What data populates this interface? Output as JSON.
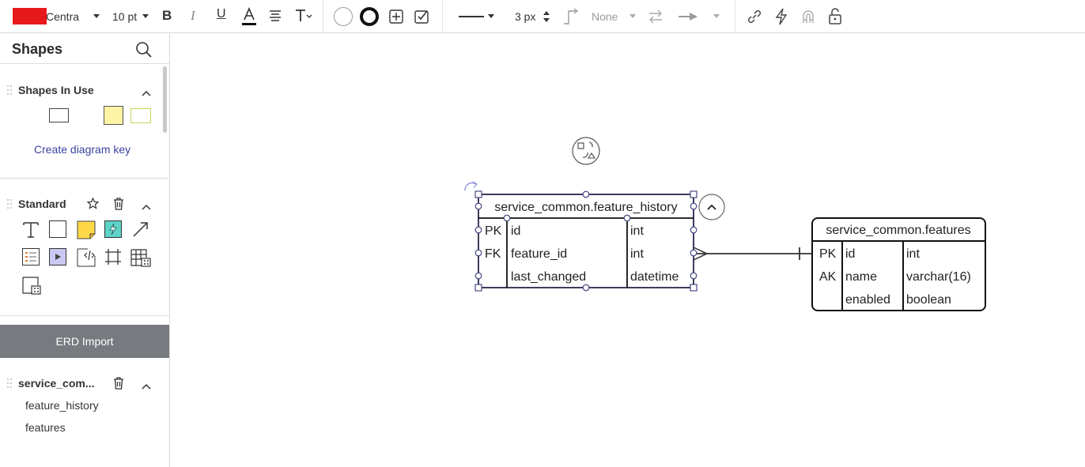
{
  "toolbar": {
    "font_name": "Centra",
    "font_size": "10 pt",
    "line_width": "3 px",
    "endpoint": "None",
    "colors": {
      "fill_swatch": "#e8191b",
      "text_underline": "#111111"
    }
  },
  "sidebar": {
    "title": "Shapes",
    "shapes_in_use": {
      "title": "Shapes In Use",
      "create_key": "Create diagram key",
      "swatches": [
        "#ffffff",
        "#fff3a6",
        "#ffffff"
      ]
    },
    "standard": {
      "title": "Standard"
    },
    "erd_import": "ERD Import",
    "library": {
      "title": "service_com...",
      "items": [
        "feature_history",
        "features"
      ]
    }
  },
  "diagram": {
    "table1": {
      "title": "service_common.feature_history",
      "rows": [
        {
          "key": "PK",
          "name": "id",
          "type": "int"
        },
        {
          "key": "FK",
          "name": "feature_id",
          "type": "int"
        },
        {
          "key": "",
          "name": "last_changed",
          "type": "datetime"
        }
      ]
    },
    "table2": {
      "title": "service_common.features",
      "rows": [
        {
          "key": "PK",
          "name": "id",
          "type": "int"
        },
        {
          "key": "AK",
          "name": "name",
          "type": "varchar(16)"
        },
        {
          "key": "",
          "name": "enabled",
          "type": "boolean"
        }
      ]
    },
    "colors": {
      "selection": "#3a3a7a",
      "table_border": "#111111"
    }
  }
}
